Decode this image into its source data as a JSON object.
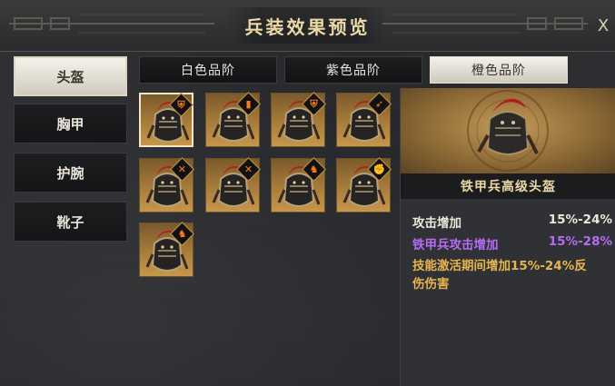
{
  "header": {
    "title": "兵装效果预览",
    "close_label": "X"
  },
  "nav": {
    "items": [
      {
        "label": "头盔",
        "active": true
      },
      {
        "label": "胸甲",
        "active": false
      },
      {
        "label": "护腕",
        "active": false
      },
      {
        "label": "靴子",
        "active": false
      }
    ]
  },
  "tabs": [
    {
      "label": "白色品阶",
      "active": false
    },
    {
      "label": "紫色品阶",
      "active": false
    },
    {
      "label": "橙色品阶",
      "active": true
    }
  ],
  "grid": {
    "items": [
      {
        "name": "helmet-slot-1",
        "icon": "shield-emblem-icon",
        "selected": true
      },
      {
        "name": "helmet-slot-2",
        "icon": "tower-shield-icon",
        "selected": false
      },
      {
        "name": "helmet-slot-3",
        "icon": "shield-emblem-icon",
        "selected": false
      },
      {
        "name": "helmet-slot-4",
        "icon": "bow-arrow-icon",
        "selected": false
      },
      {
        "name": "helmet-slot-5",
        "icon": "crossbow-icon",
        "selected": false
      },
      {
        "name": "helmet-slot-6",
        "icon": "crossbow-icon",
        "selected": false
      },
      {
        "name": "helmet-slot-7",
        "icon": "horse-icon",
        "selected": false
      },
      {
        "name": "helmet-slot-8",
        "icon": "fist-icon",
        "selected": false
      },
      {
        "name": "helmet-slot-9",
        "icon": "horse-icon",
        "selected": false
      }
    ]
  },
  "detail": {
    "item_name": "铁甲兵高级头盔",
    "stats": [
      {
        "label": "攻击增加",
        "value": "15%-24%",
        "color": "#ece7dc"
      },
      {
        "label": "铁甲兵攻击增加",
        "value": "15%-28%",
        "color": "#b56cf5"
      },
      {
        "label": "技能激活期间增加",
        "value": "15%-24%反",
        "color": "#e8b44e"
      }
    ],
    "stat_continuation": "伤伤害"
  },
  "colors": {
    "accent_gold": "#ecd9a6",
    "quality_orange": "#c7964b",
    "purple": "#b56cf5"
  }
}
